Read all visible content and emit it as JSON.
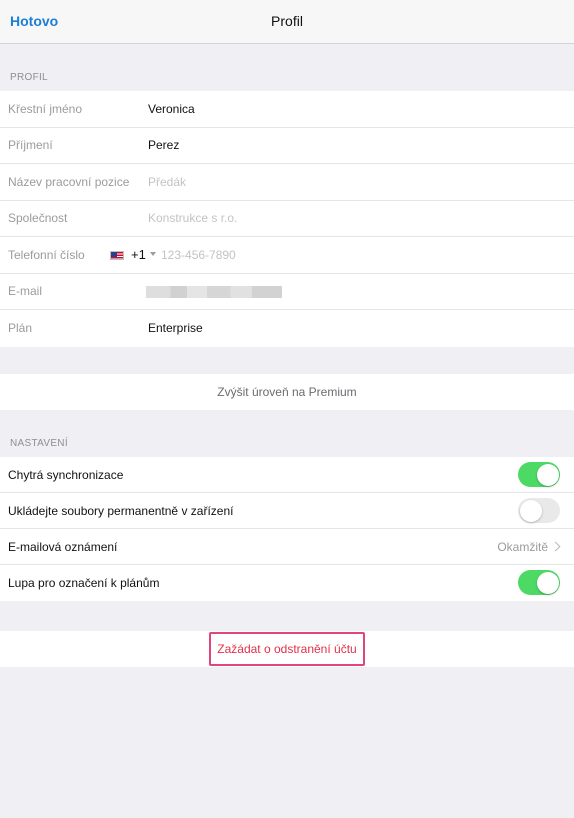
{
  "navbar": {
    "done_label": "Hotovo",
    "title": "Profil"
  },
  "profile": {
    "header": "PROFIL",
    "rows": [
      {
        "label": "Křestní jméno",
        "value": "Veronica"
      },
      {
        "label": "Příjmení",
        "value": "Perez"
      },
      {
        "label": "Název pracovní pozice",
        "placeholder": "Předák"
      },
      {
        "label": "Společnost",
        "placeholder": "Konstrukce s r.o."
      },
      {
        "label": "Telefonní číslo",
        "country_code": "+1",
        "placeholder": "123-456-7890",
        "flag_icon": "us-flag-icon"
      },
      {
        "label": "E-mail"
      },
      {
        "label": "Plán",
        "value": "Enterprise"
      }
    ]
  },
  "premium": {
    "label": "Zvýšit úroveň na Premium"
  },
  "settings": {
    "header": "NASTAVENÍ",
    "rows": [
      {
        "label": "Chytrá synchronizace",
        "toggle": true
      },
      {
        "label": "Ukládejte soubory permanentně v zařízení",
        "toggle": false
      },
      {
        "label": "E-mailová oznámení",
        "detail": "Okamžitě",
        "icon": "chevron-right-icon"
      },
      {
        "label": "Lupa pro označení k plánům",
        "toggle": true
      }
    ]
  },
  "delete_account": {
    "label": "Zažádat o odstranění účtu",
    "highlight_color": "#e0457b"
  },
  "colors": {
    "accent": "#1b7fd3",
    "toggle_on": "#4cd964",
    "destructive": "#e0314a"
  }
}
